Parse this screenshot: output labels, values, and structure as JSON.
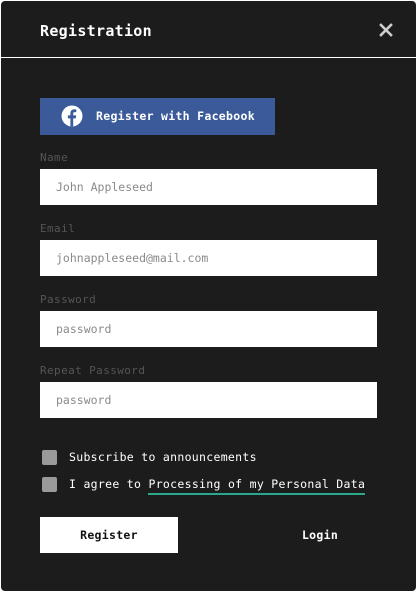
{
  "modal": {
    "title": "Registration",
    "close_icon": "close-icon"
  },
  "facebook": {
    "label": "Register with Facebook",
    "icon": "facebook-icon",
    "color": "#3a5a99"
  },
  "fields": {
    "name": {
      "label": "Name",
      "placeholder": "John Appleseed",
      "value": ""
    },
    "email": {
      "label": "Email",
      "placeholder": "johnappleseed@mail.com",
      "value": ""
    },
    "password": {
      "label": "Password",
      "placeholder": "password",
      "value": ""
    },
    "repeat_password": {
      "label": "Repeat Password",
      "placeholder": "password",
      "value": ""
    }
  },
  "checkboxes": {
    "subscribe": {
      "label": "Subscribe to announcements",
      "checked": false
    },
    "agree": {
      "prefix": "I agree to",
      "link": "Processing of my Personal Data",
      "checked": false
    }
  },
  "actions": {
    "register": "Register",
    "login": "Login"
  },
  "colors": {
    "background": "#1c1c1c",
    "accent_underline": "#2aa88e"
  }
}
